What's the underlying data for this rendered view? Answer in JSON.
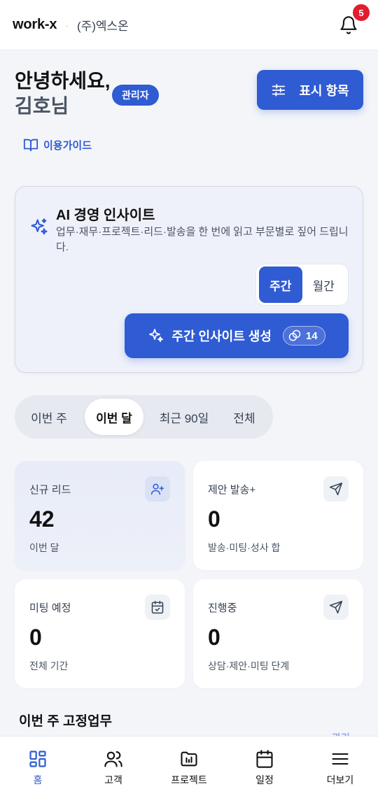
{
  "header": {
    "brand": "work-x",
    "separator": "·",
    "company": "(주)엑스온",
    "notification_count": "5"
  },
  "greeting": {
    "line1": "안녕하세요,",
    "line2": "김호님",
    "role_badge": "관리자"
  },
  "toolbar": {
    "display_items_label": "표시 항목"
  },
  "guide_link": "이용가이드",
  "ai_insight": {
    "title": "AI 경영 인사이트",
    "description": "업무·재무·프로젝트·리드·발송을 한 번에 읽고 부문별로 짚어 드립니다.",
    "period_options": [
      {
        "label": "주간",
        "active": true
      },
      {
        "label": "월간",
        "active": false
      }
    ],
    "generate_label": "주간 인사이트 생성",
    "credit_count": "14"
  },
  "range_tabs": [
    {
      "label": "이번 주",
      "active": false
    },
    {
      "label": "이번 달",
      "active": true
    },
    {
      "label": "최근 90일",
      "active": false
    },
    {
      "label": "전체",
      "active": false
    }
  ],
  "stats": [
    {
      "label": "신규 리드",
      "value": "42",
      "sub": "이번 달",
      "icon": "user-plus-icon"
    },
    {
      "label": "제안 발송+",
      "value": "0",
      "sub": "발송·미팅·성사 합",
      "icon": "send-icon"
    },
    {
      "label": "미팅 예정",
      "value": "0",
      "sub": "전체 기간",
      "icon": "calendar-check-icon"
    },
    {
      "label": "진행중",
      "value": "0",
      "sub": "상담·제안·미팅 단계",
      "icon": "send-icon"
    }
  ],
  "section": {
    "title": "이번 주 고정업무",
    "link": "관리 >"
  },
  "bottom_nav": [
    {
      "label": "홈",
      "icon": "home-grid-icon",
      "active": true
    },
    {
      "label": "고객",
      "icon": "users-icon",
      "active": false
    },
    {
      "label": "프로젝트",
      "icon": "folder-chart-icon",
      "active": false
    },
    {
      "label": "일정",
      "icon": "calendar-icon",
      "active": false
    },
    {
      "label": "더보기",
      "icon": "menu-icon",
      "active": false
    }
  ],
  "colors": {
    "accent": "#2f5bd3",
    "badge": "#e11d2e",
    "background": "#f3f5f9"
  }
}
